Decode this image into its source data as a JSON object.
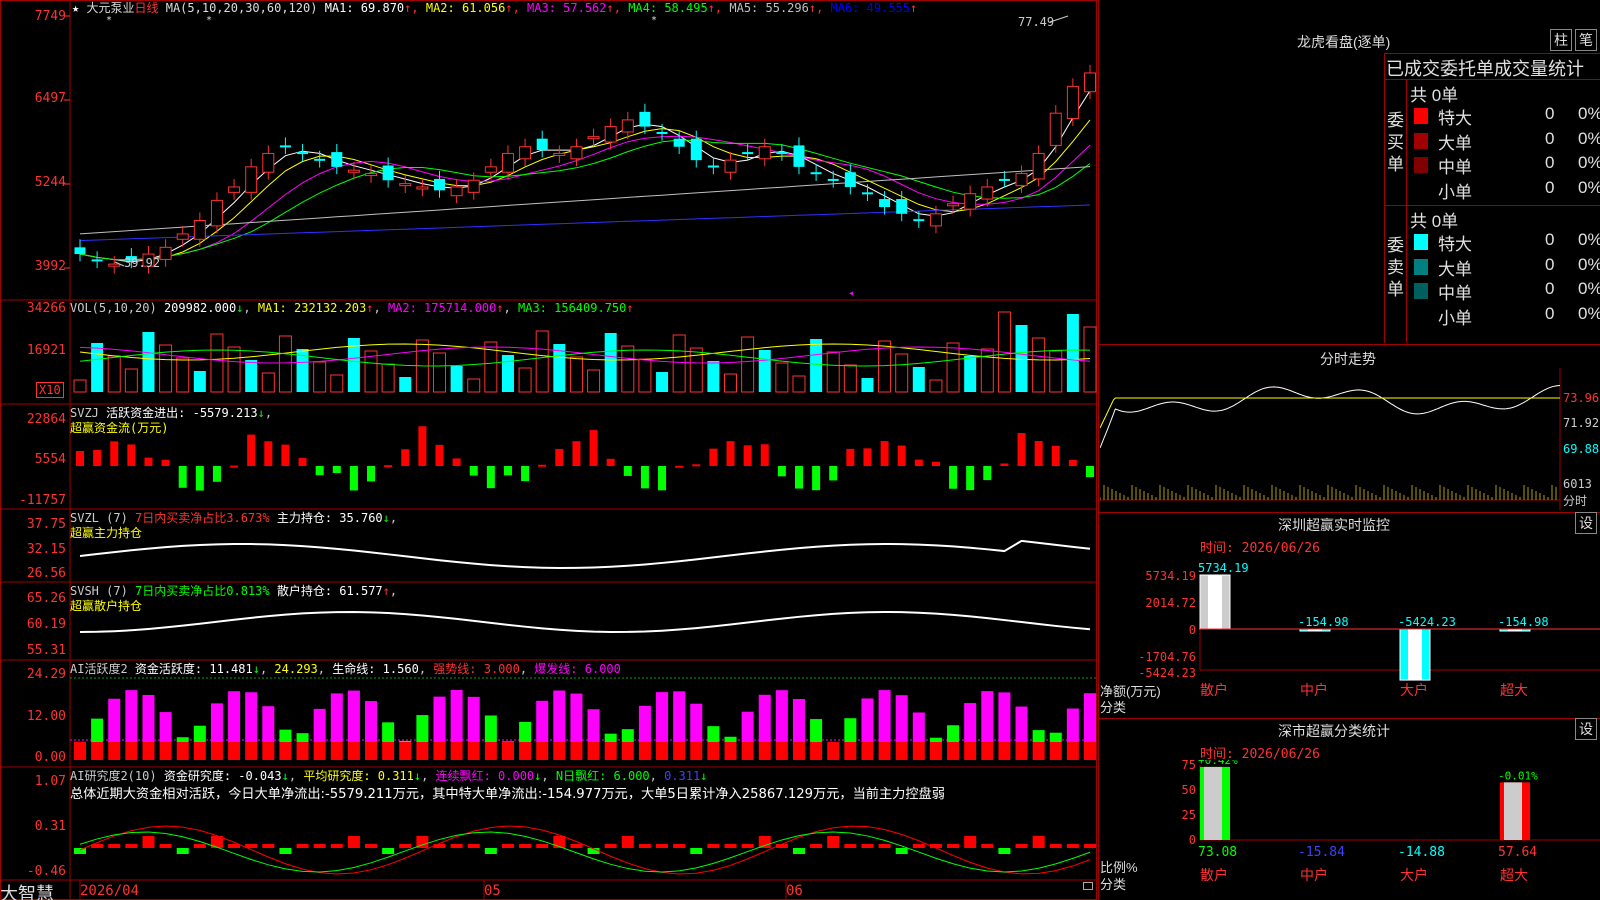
{
  "app": {
    "brand": "大智慧",
    "star": "★"
  },
  "main": {
    "stock_name": "大元泵业",
    "period": "日线",
    "ma_params": "MA(5,10,20,30,60,120)",
    "ma_values": [
      {
        "label": "MA1: 69.870",
        "color": "#ffffff"
      },
      {
        "label": "MA2: 61.056",
        "color": "#ffff00"
      },
      {
        "label": "MA3: 57.562",
        "color": "#ff00ff"
      },
      {
        "label": "MA4: 58.495",
        "color": "#00ff00"
      },
      {
        "label": "MA5: 55.296",
        "color": "#c0c0c0"
      },
      {
        "label": "MA6: 49.555",
        "color": "#0000ff"
      }
    ],
    "arrow_up": "↑",
    "y_ticks": [
      "7749",
      "6497",
      "5244",
      "3992"
    ],
    "high_label": "77.49",
    "low_label": "39.92"
  },
  "vol": {
    "label": "VOL(5,10,20)",
    "value": "209982.000",
    "arrow_down": "↓",
    "ma1": "MA1: 232132.203",
    "ma2": "MA2: 175714.000",
    "ma3": "MA3: 156409.750",
    "y_ticks": [
      "34266",
      "16921"
    ],
    "unit": "X10"
  },
  "svzj": {
    "label": "SVZJ",
    "title": "活跃资金进出: -5579.213",
    "sub": "超赢资金流(万元)",
    "y_ticks": [
      "22864",
      "5554",
      "-11757"
    ]
  },
  "svzl": {
    "label": "SVZL (7)",
    "ratio": "7日内买卖净占比3.673%",
    "hold": "主力持仓: 35.760",
    "sub": "超赢主力持仓",
    "y_ticks": [
      "37.75",
      "32.15",
      "26.56"
    ]
  },
  "svsh": {
    "label": "SVSH (7)",
    "ratio": "7日内买卖净占比0.813%",
    "hold": "散户持仓: 61.577",
    "sub": "超赢散户持仓",
    "y_ticks": [
      "65.26",
      "60.19",
      "55.31"
    ]
  },
  "ai1": {
    "label": "AI活跃度2",
    "a": "资金活跃度: 11.481",
    "b": "24.293",
    "c": "生命线: 1.560",
    "d": "强势线: 3.000",
    "e": "爆发线: 6.000",
    "y_ticks": [
      "24.29",
      "12.00",
      "0.00"
    ]
  },
  "ai2": {
    "label": "AI研究度2(10)",
    "a": "资金研究度: -0.043",
    "b": "平均研究度: 0.311",
    "c": "连续飘红: 0.000",
    "d": "N日飘红: 6.000",
    "e": "0.311",
    "summary": "总体近期大资金相对活跃，今日大单净流出:-5579.211万元，其中特大单净流出:-154.977万元，大单5日累计净入25867.129万元，当前主力控盘弱",
    "y_ticks": [
      "1.07",
      "0.31",
      "-0.46"
    ]
  },
  "xaxis": {
    "labels": [
      "2026/04",
      "05",
      "06"
    ]
  },
  "lhb": {
    "title": "龙虎看盘(逐单)",
    "btn1": "柱",
    "btn2": "笔",
    "header": "已成交委托单成交量统计",
    "buy": {
      "side": "委买单",
      "total": "共 0单",
      "rows": [
        {
          "name": "特大",
          "count": "0",
          "pct": "0%",
          "color": "#ff0000"
        },
        {
          "name": "大单",
          "count": "0",
          "pct": "0%",
          "color": "#a00000"
        },
        {
          "name": "中单",
          "count": "0",
          "pct": "0%",
          "color": "#800000"
        },
        {
          "name": "小单",
          "count": "0",
          "pct": "0%",
          "color": ""
        }
      ]
    },
    "sell": {
      "side": "委卖单",
      "total": "共 0单",
      "rows": [
        {
          "name": "特大",
          "count": "0",
          "pct": "0%",
          "color": "#00ffff"
        },
        {
          "name": "大单",
          "count": "0",
          "pct": "0%",
          "color": "#008080"
        },
        {
          "name": "中单",
          "count": "0",
          "pct": "0%",
          "color": "#006060"
        },
        {
          "name": "小单",
          "count": "0",
          "pct": "0%",
          "color": ""
        }
      ]
    }
  },
  "intraday": {
    "title": "分时走势",
    "r1": "73.96",
    "r2": "71.92",
    "r3": "69.88",
    "vol": "6013",
    "unit": "分时"
  },
  "monitor": {
    "title": "深圳超赢实时监控",
    "btn": "设",
    "time": "时间: 2026/06/26",
    "ylab": "净额(万元)",
    "xlab": "分类",
    "y_ticks": [
      "5734.19",
      "2014.72",
      "0",
      "-1704.76",
      "-5424.23"
    ],
    "cats": [
      "散户",
      "中户",
      "大户",
      "超大"
    ],
    "vals": [
      "5734.19",
      "-154.98",
      "-5424.23",
      "-154.98"
    ]
  },
  "classify": {
    "title": "深市超赢分类统计",
    "btn": "设",
    "time": "时间: 2026/06/26",
    "ylab": "比例%",
    "xlab": "分类",
    "y_ticks": [
      "75",
      "50",
      "25",
      "0"
    ],
    "cats": [
      "散户",
      "中户",
      "大户",
      "超大"
    ],
    "pct_top": [
      "+0.42%",
      "-0.01%"
    ],
    "vals": [
      "73.08",
      "-15.84",
      "-14.88",
      "57.64"
    ]
  },
  "chart_data": [
    {
      "type": "candlestick",
      "title": "大元泵业 日线",
      "ylim": [
        39.92,
        77.49
      ],
      "series": [
        {
          "name": "MA1",
          "last": 69.87
        },
        {
          "name": "MA2",
          "last": 61.056
        },
        {
          "name": "MA3",
          "last": 57.562
        },
        {
          "name": "MA4",
          "last": 58.495
        },
        {
          "name": "MA5",
          "last": 55.296
        },
        {
          "name": "MA6",
          "last": 49.555
        }
      ],
      "high": 77.49,
      "low": 39.92
    },
    {
      "type": "bar",
      "title": "VOL(5,10,20)",
      "value": 209982.0,
      "series": [
        {
          "name": "MA1",
          "last": 232132.203
        },
        {
          "name": "MA2",
          "last": 175714.0
        },
        {
          "name": "MA3",
          "last": 156409.75
        }
      ]
    },
    {
      "type": "bar",
      "title": "深圳超赢实时监控",
      "categories": [
        "散户",
        "中户",
        "大户",
        "超大"
      ],
      "values": [
        5734.19,
        -154.98,
        -5424.23,
        -154.98
      ],
      "ylim": [
        -5424.23,
        5734.19
      ]
    },
    {
      "type": "bar",
      "title": "深市超赢分类统计",
      "categories": [
        "散户",
        "中户",
        "大户",
        "超大"
      ],
      "values": [
        73.08,
        -15.84,
        -14.88,
        57.64
      ],
      "ylim": [
        0,
        75
      ]
    }
  ]
}
